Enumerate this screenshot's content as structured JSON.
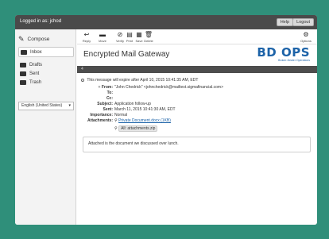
{
  "topbar": {
    "user": "Logged in as: jchod",
    "help": "Help",
    "logout": "Logout"
  },
  "sidebar": {
    "compose": "Compose",
    "folders": [
      {
        "label": "Inbox",
        "active": true
      },
      {
        "label": "Drafts",
        "active": false
      },
      {
        "label": "Sent",
        "active": false
      },
      {
        "label": "Trash",
        "active": false
      }
    ],
    "language": "English (United States)"
  },
  "toolbar": {
    "reply": "Reply",
    "move": "Move",
    "verify": "Verify",
    "print": "Print",
    "save": "Save",
    "delete": "Delete",
    "options": "Options"
  },
  "header": {
    "title": "Encrypted Mail Gateway",
    "logo_main": "BD OPS",
    "logo_sub": "Broker-Dealer Operations",
    "bar_number": "4"
  },
  "message": {
    "notice": "This message will expire after April 10, 2015 10:41:35 AM, EDT",
    "from_label": "From:",
    "from": "\"John Chedrick\" <johnchedrick@mailtest.sigmafinancial.com>",
    "to_label": "To:",
    "to": "",
    "cc_label": "Cc:",
    "cc": "",
    "subject_label": "Subject:",
    "subject": "Application follow-up",
    "sent_label": "Sent:",
    "sent": "March 11, 2015 10:41:30 AM, EDT",
    "importance_label": "Importance:",
    "importance": "Normal",
    "attachments_label": "Attachments:",
    "attachment_1": "Private Document.docx (1KB)",
    "attachment_all": "All: attachments.zip",
    "body": "Attached is the document we discussed over lunch."
  }
}
